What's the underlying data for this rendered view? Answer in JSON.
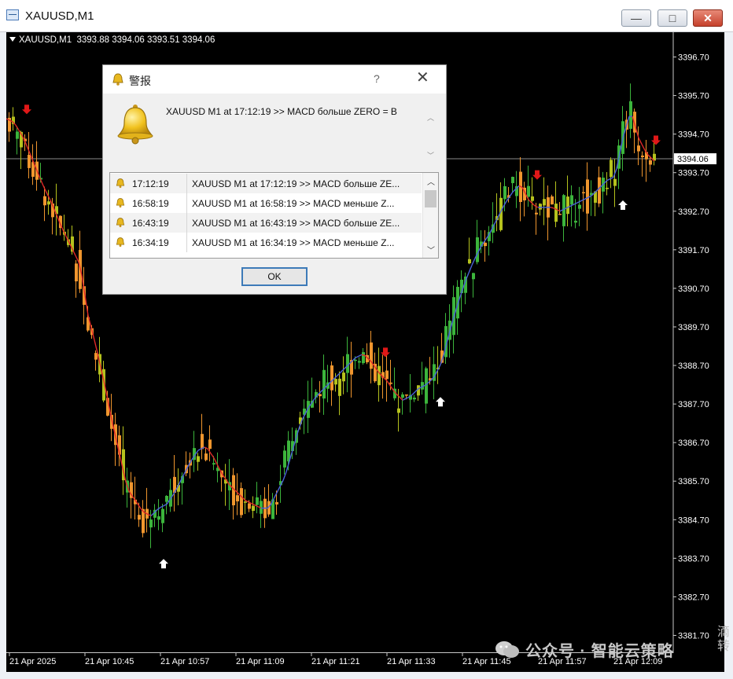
{
  "window": {
    "title": "XAUUSD,M1",
    "minimize": "—",
    "maximize": "□",
    "close": "✕"
  },
  "chart": {
    "symbol_info": "XAUUSD,M1  3393.88 3394.06 3393.51 3394.06",
    "current_price_label": "3394.06",
    "current_price": 3394.06,
    "price_labels": [
      "3396.70",
      "3395.70",
      "3394.70",
      "3393.70",
      "3392.70",
      "3391.70",
      "3390.70",
      "3389.70",
      "3388.70",
      "3387.70",
      "3386.70",
      "3385.70",
      "3384.70",
      "3383.70",
      "3382.70",
      "3381.70"
    ],
    "time_labels": [
      "21 Apr 2025",
      "21 Apr 10:45",
      "21 Apr 10:57",
      "21 Apr 11:09",
      "21 Apr 11:21",
      "21 Apr 11:33",
      "21 Apr 11:45",
      "21 Apr 11:57",
      "21 Apr 12:09"
    ],
    "colors": {
      "background": "#000000",
      "bull": "#3cb53c",
      "bear": "#f0962e",
      "neutral": "#b5c21d",
      "ma_up": "#4a62d8",
      "ma_down": "#e02828",
      "arrow_sell": "#e01818",
      "arrow_buy": "#ffffff"
    }
  },
  "dialog": {
    "title": "警报",
    "help": "?",
    "close": "✕",
    "message": "XAUUSD M1 at 17:12:19  >>  MACD больше ZERO  =  B",
    "alerts": [
      {
        "time": "17:12:19",
        "message": "XAUUSD M1 at 17:12:19  >>  MACD больше ZE..."
      },
      {
        "time": "16:58:19",
        "message": "XAUUSD M1 at 16:58:19  >>  MACD меньше Z..."
      },
      {
        "time": "16:43:19",
        "message": "XAUUSD M1 at 16:43:19  >>  MACD больше ZE..."
      },
      {
        "time": "16:34:19",
        "message": "XAUUSD M1 at 16:34:19  >>  MACD меньше Z..."
      }
    ],
    "ok_label": "OK"
  },
  "watermark": {
    "text": "公众号 · 智能云策略",
    "corner": "滴 转"
  }
}
